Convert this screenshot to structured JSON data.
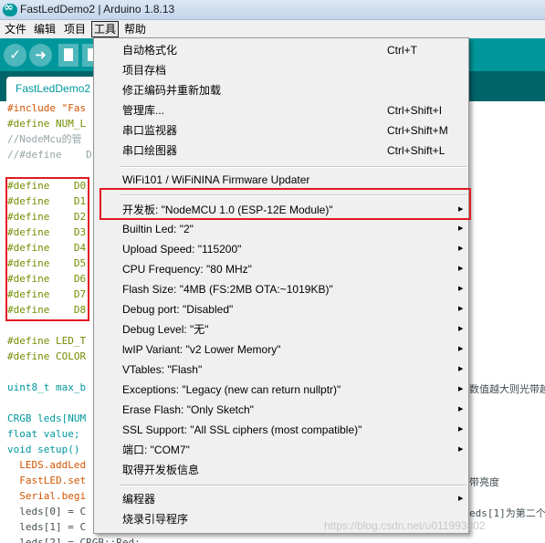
{
  "window": {
    "title": "FastLedDemo2 | Arduino 1.8.13"
  },
  "menubar": {
    "items": [
      "文件",
      "编辑",
      "项目",
      "工具",
      "帮助"
    ],
    "active": "工具"
  },
  "toolbar": {
    "verify_icon": "checkmark-icon",
    "upload_icon": "arrow-right-icon",
    "new_icon": "new-file-icon"
  },
  "tab": {
    "label": "FastLedDemo2"
  },
  "editor": {
    "lines": [
      "#include \"Fas",
      "#define NUM_L",
      "//NodeMcu的管",
      "//#define    D",
      "#define    D0",
      "#define    D1",
      "#define    D2",
      "#define    D3",
      "#define    D4",
      "#define    D5",
      "#define    D6",
      "#define    D7",
      "#define    D8",
      "#define LED_T",
      "#define COLOR",
      "uint8_t max_b",
      "CRGB leds[NUM",
      "float value;",
      "void setup()",
      "  LEDS.addLed",
      "  FastLED.set",
      "  Serial.begi",
      "  leds[0] = C",
      "  leds[1] = C",
      "  leds[2] = CRGB::Red;"
    ],
    "right_fragments": [
      "数值越大则光带越",
      "带亮度",
      "eds[1]为第二个"
    ]
  },
  "tools_menu": {
    "group1": [
      {
        "label": "自动格式化",
        "shortcut": "Ctrl+T"
      },
      {
        "label": "项目存档",
        "shortcut": ""
      },
      {
        "label": "修正编码并重新加载",
        "shortcut": ""
      },
      {
        "label": "管理库...",
        "shortcut": "Ctrl+Shift+I"
      },
      {
        "label": "串口监视器",
        "shortcut": "Ctrl+Shift+M"
      },
      {
        "label": "串口绘图器",
        "shortcut": "Ctrl+Shift+L"
      }
    ],
    "wifi_updater": "WiFi101 / WiFiNINA Firmware Updater",
    "board": "开发板: \"NodeMCU 1.0 (ESP-12E Module)\"",
    "settings": [
      "Builtin Led: \"2\"",
      "Upload Speed: \"115200\"",
      "CPU Frequency: \"80 MHz\"",
      "Flash Size: \"4MB (FS:2MB OTA:~1019KB)\"",
      "Debug port: \"Disabled\"",
      "Debug Level: \"无\"",
      "lwIP Variant: \"v2 Lower Memory\"",
      "VTables: \"Flash\"",
      "Exceptions: \"Legacy (new can return nullptr)\"",
      "Erase Flash: \"Only Sketch\"",
      "SSL Support: \"All SSL ciphers (most compatible)\"",
      "端口: \"COM7\""
    ],
    "board_info": "取得开发板信息",
    "programmer": "编程器",
    "burn_bootloader": "烧录引导程序"
  },
  "watermark": "https://blog.csdn.net/u011993802"
}
